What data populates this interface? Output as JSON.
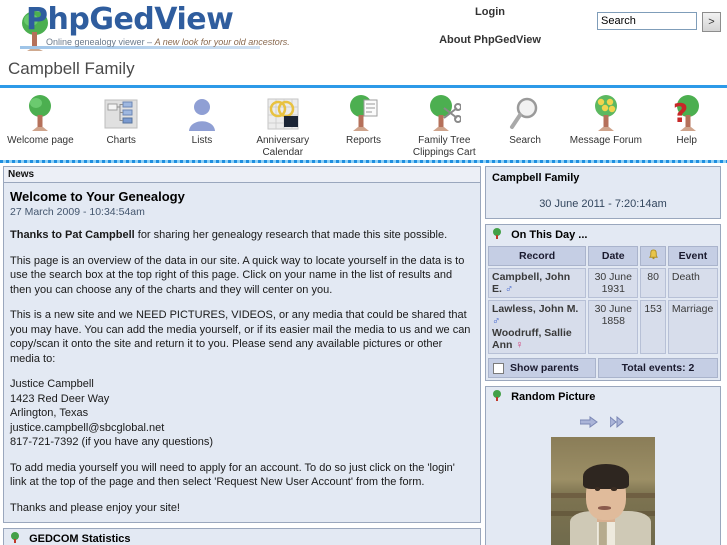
{
  "header": {
    "logo_title": "PhpGedView",
    "logo_tagline_plain": "Online genealogy viewer – ",
    "logo_tagline_italic": "A new look for your old ancestors.",
    "login_label": "Login",
    "about_label": "About PhpGedView",
    "search_value": "Search",
    "search_placeholder": "Search",
    "search_button_label": ">"
  },
  "site": {
    "title": "Campbell Family"
  },
  "nav": {
    "items": [
      {
        "label": "Welcome page",
        "icon": "tree-icon"
      },
      {
        "label": "Charts",
        "icon": "charts-icon"
      },
      {
        "label": "Lists",
        "icon": "person-icon"
      },
      {
        "label": "Anniversary\nCalendar",
        "icon": "calendar-icon"
      },
      {
        "label": "Reports",
        "icon": "report-tree-icon"
      },
      {
        "label": "Family Tree\nClippings Cart",
        "icon": "scissors-tree-icon"
      },
      {
        "label": "Search",
        "icon": "magnifier-icon"
      },
      {
        "label": "Message Forum",
        "icon": "forum-tree-icon"
      },
      {
        "label": "Help",
        "icon": "question-tree-icon"
      }
    ]
  },
  "news": {
    "block_title": "News",
    "headline": "Welcome to Your Genealogy",
    "date": "27 March 2009 - 10:34:54am",
    "thanks_bold": "Thanks to Pat Campbell",
    "thanks_rest": " for sharing her genealogy research that made this site possible.",
    "para_overview": "This page is an overview of the data in our site. A quick way to locate yourself in the data is to use the search box at the top right of this page. Click on your name in the list of results and then you can choose any of the charts and they will center on you.",
    "para_media": "This is a new site and we NEED PICTURES, VIDEOS, or any media that could be shared that you may have. You can add the media yourself, or if its easier mail the media to us and we can copy/scan it onto the site and return it to you. Please send any available pictures or other media to:",
    "contact": [
      "Justice Campbell",
      "1423 Red Deer Way",
      "Arlington, Texas",
      "justice.campbell@sbcglobal.net",
      "817-721-7392 (if you have any questions)"
    ],
    "para_account": "To add media yourself you will need to apply for an account. To do so just click on the 'login' link at the top of the page and then select 'Request New User Account' from the form.",
    "para_closing": "Thanks and please enjoy your site!"
  },
  "gedcom": {
    "title": "GEDCOM Statistics"
  },
  "family_block": {
    "title": "Campbell Family",
    "datetime": "30 June 2011 - 7:20:14am"
  },
  "on_this_day": {
    "title": "On This Day ...",
    "columns": [
      "Record",
      "Date",
      "bell-icon",
      "Event"
    ],
    "rows": [
      {
        "record": "Campbell, John E.",
        "record_sex": "♂",
        "record2": "",
        "record2_sex": "",
        "date": "30 June 1931",
        "age": "80",
        "event": "Death"
      },
      {
        "record": "Lawless, John M.",
        "record_sex": "♂",
        "record2": "Woodruff, Sallie Ann",
        "record2_sex": "♀",
        "date": "30 June 1858",
        "age": "153",
        "event": "Marriage"
      }
    ],
    "show_parents_label": "Show parents",
    "total_label": "Total events: 2"
  },
  "random_picture": {
    "title": "Random Picture",
    "next_arrow": "next-arrow-icon",
    "last_arrow": "double-arrow-icon"
  },
  "colors": {
    "accent_blue": "#2d9ae8",
    "panel_bg": "#e3e9f3",
    "panel_border": "#9aa7bd",
    "table_header": "#c5cee4",
    "logo_blue": "#2f5d9e"
  }
}
